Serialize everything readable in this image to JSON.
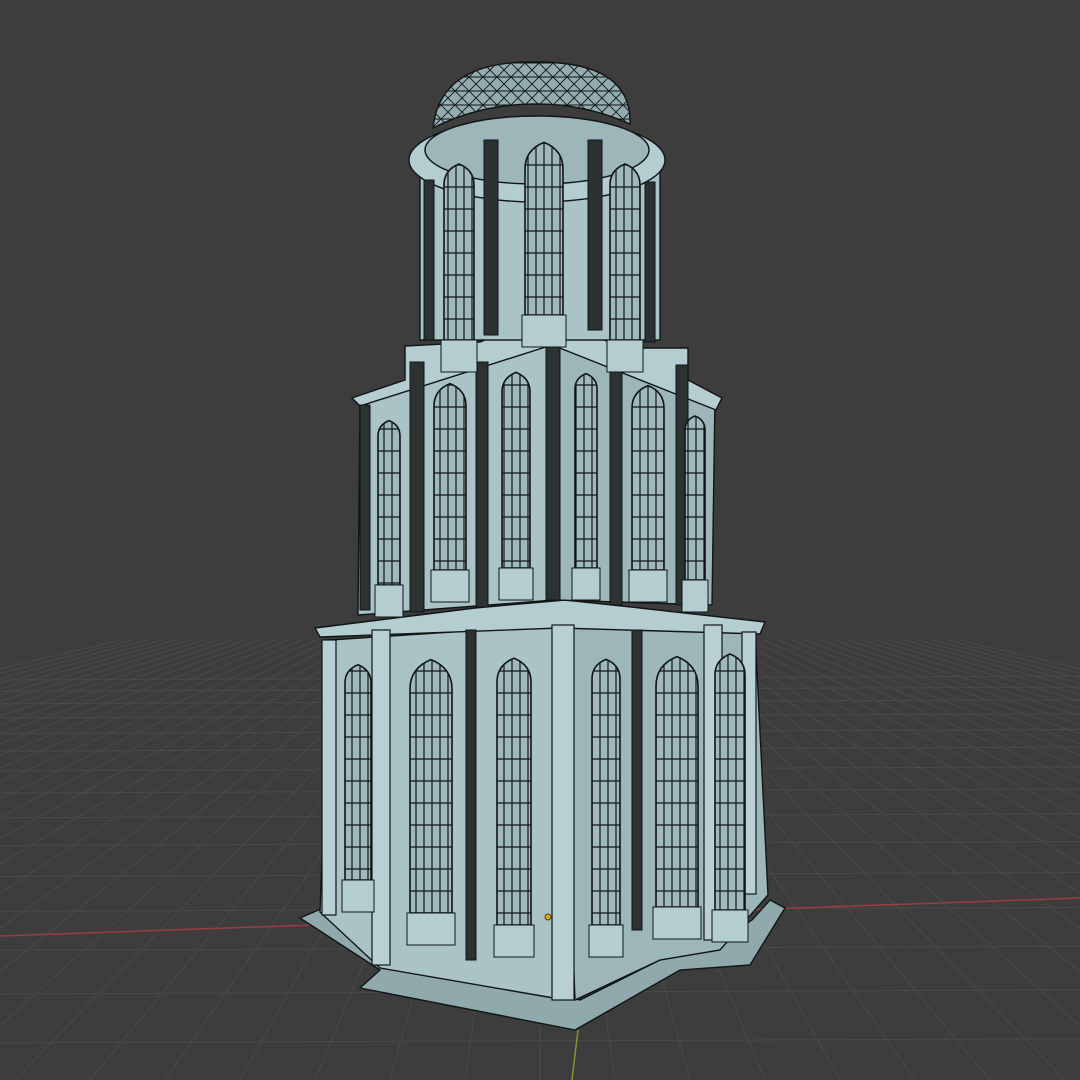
{
  "viewport": {
    "background_color": "#3d3d3d",
    "grid_color": "#4a4a4a",
    "x_axis_color": "#9a3b45",
    "y_axis_color": "#7d9a2c",
    "origin_marker_color": "#e0a020"
  },
  "model": {
    "surface_color": "#a9c3c6",
    "shade_color": "#8fa9ad",
    "wire_color": "#111516",
    "dark_trim_color": "#2c3132",
    "tiers": 3,
    "has_dome": true
  }
}
